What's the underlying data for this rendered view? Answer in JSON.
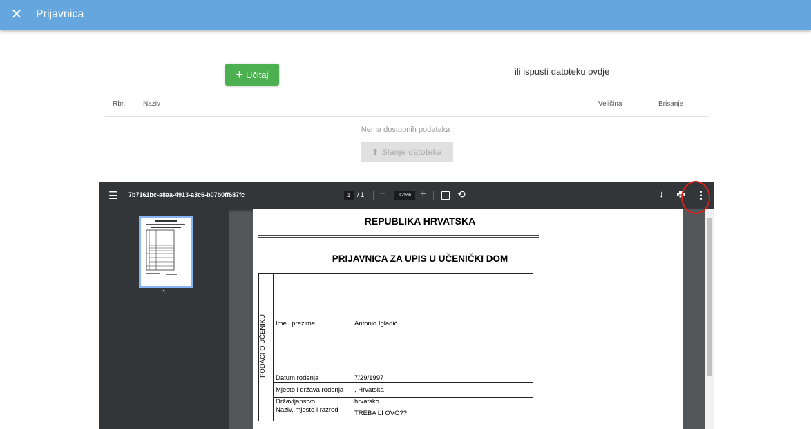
{
  "header": {
    "close_icon": "close-icon",
    "title": "Prijavnica"
  },
  "upload": {
    "button_label": "Učitaj",
    "drop_text": "ili ispusti datoteku ovdje",
    "color": "#4caf50"
  },
  "table": {
    "columns": {
      "rbr": "Rbr.",
      "naziv": "Naziv",
      "velicina": "Veličina",
      "brisanje": "Brisanje"
    },
    "empty_text": "Nema dostupnih podataka"
  },
  "send_button": {
    "label": "Slanje datoteka",
    "icon": "upload-icon"
  },
  "pdf_viewer": {
    "filename": "7b7161bc-a8aa-4913-a3c6-b07b0ff687fc",
    "current_page": "1",
    "total_pages": "/ 1",
    "zoom": "125%",
    "thumbnail_page": "1",
    "icons": [
      "menu-icon",
      "zoom-out-icon",
      "zoom-in-icon",
      "fit-page-icon",
      "rotate-icon",
      "download-icon",
      "print-icon",
      "more-icon"
    ]
  },
  "document": {
    "title": "REPUBLIKA HRVATSKA",
    "form_title": "PRIJAVNICA ZA UPIS U UČENIČKI DOM",
    "section_label": "PODACI O UČENIKU",
    "rows": [
      {
        "label": "Ime i prezime",
        "value": "Antonio Igladić"
      },
      {
        "label": "Datum rođenja",
        "value": "7/29/1997"
      },
      {
        "label": "Mjesto i država rođenja",
        "value": ", Hrvatska"
      },
      {
        "label": "Državljanstvo",
        "value": "hrvatsko"
      },
      {
        "label": "Naziv, mjesto i razred",
        "value": "TREBA LI OVO??"
      }
    ]
  },
  "colors": {
    "header_bg": "#64a6dd",
    "viewer_bg": "#525659",
    "viewer_toolbar": "#323639",
    "annotation": "#e0211a"
  }
}
